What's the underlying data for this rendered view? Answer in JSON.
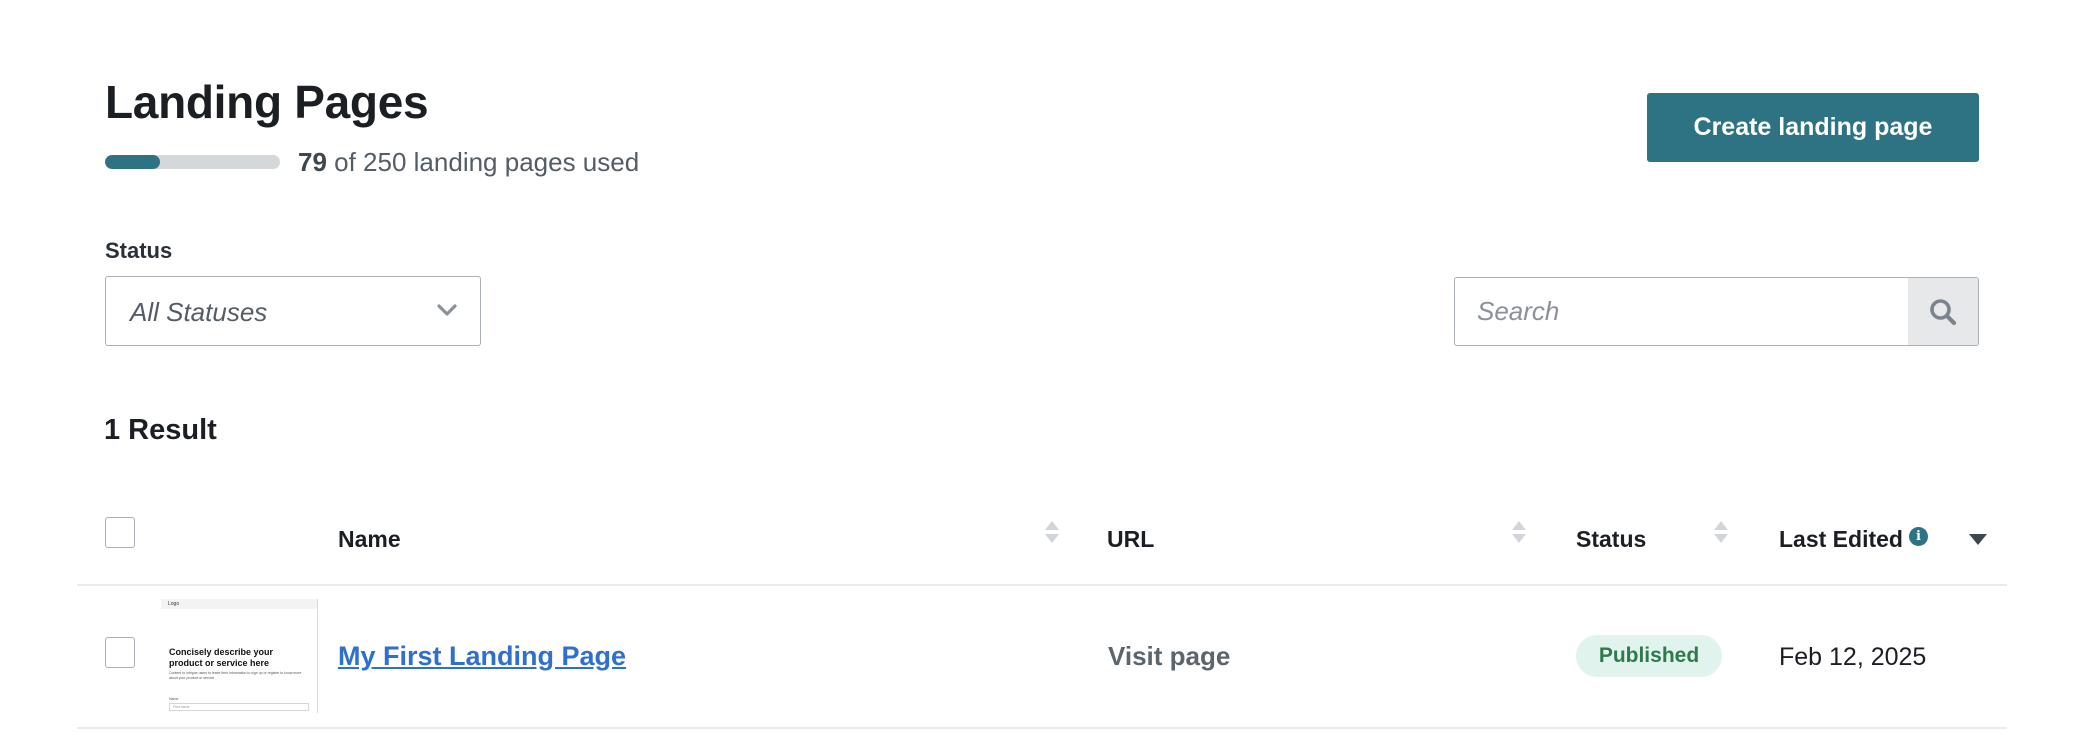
{
  "header": {
    "title": "Landing Pages",
    "usage": {
      "used": 79,
      "total": 250,
      "used_label": "79",
      "rest_label": " of 250 landing pages used",
      "fraction": 0.316
    },
    "create_button_label": "Create landing page"
  },
  "filters": {
    "status_label": "Status",
    "status_selected": "All Statuses",
    "search_placeholder": "Search",
    "search_value": ""
  },
  "results": {
    "count_label": "1 Result"
  },
  "table": {
    "columns": [
      {
        "key": "name",
        "label": "Name",
        "sortable": true
      },
      {
        "key": "url",
        "label": "URL",
        "sortable": true
      },
      {
        "key": "status",
        "label": "Status",
        "sortable": true
      },
      {
        "key": "last_edited",
        "label": "Last Edited",
        "sortable": true,
        "sorted": "desc",
        "info": true
      }
    ],
    "rows": [
      {
        "name": "My First Landing Page",
        "url_label": "Visit page",
        "status": "Published",
        "last_edited": "Feb 12, 2025",
        "thumbnail": {
          "logo": "Logo",
          "headline": "Concisely describe your product or service here",
          "body": "Content to intrigue users to leave their information to sign up or register to know more about your product or service",
          "field_label": "Name",
          "field_placeholder": "First name"
        }
      }
    ]
  },
  "colors": {
    "accent": "#2e7384",
    "link": "#2f6fce",
    "badge_bg": "#e0f3ec",
    "badge_text": "#2e7a4e"
  },
  "icons": {
    "select": "chevron-down-icon",
    "search": "search-icon",
    "sort": "sort-icon",
    "info": "info-icon",
    "sorted_desc": "caret-down-icon"
  }
}
